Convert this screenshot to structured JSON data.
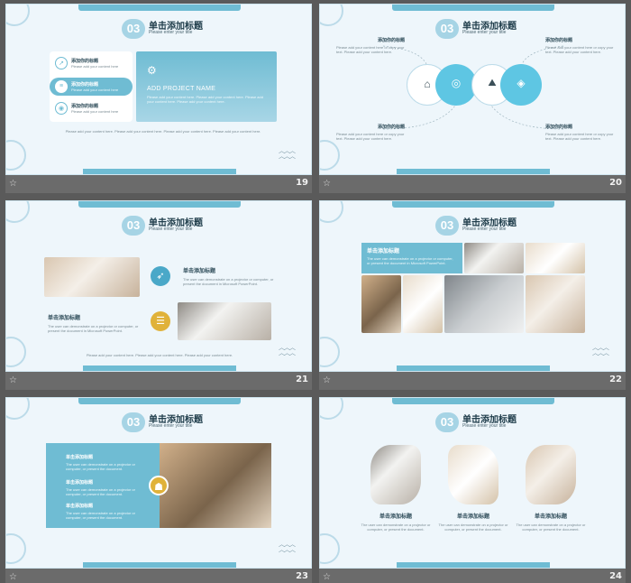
{
  "slide_title": "单击添加标题",
  "slide_subtitle": "Please enter your title",
  "logo_glyph": "03",
  "slides": [
    {
      "number": "19"
    },
    {
      "number": "20"
    },
    {
      "number": "21"
    },
    {
      "number": "22"
    },
    {
      "number": "23"
    },
    {
      "number": "24"
    }
  ],
  "s19": {
    "list": [
      {
        "label": "添加你的标题",
        "desc": "Please add your content here"
      },
      {
        "label": "添加你的标题",
        "desc": "Please add your content here"
      },
      {
        "label": "添加你的标题",
        "desc": "Please add your content here"
      }
    ],
    "project_name": "ADD PROJECT NAME",
    "project_desc": "Please add your content here. Please add your content here. Please add your content here. Please add your content here.",
    "footer": "Please add your content here. Please add your content here. Please add your content here. Please add your content here."
  },
  "s20": {
    "items": [
      {
        "label": "添加你的标题",
        "desc": "Please add your content here or copy your text. Please add your content here."
      },
      {
        "label": "添加你的标题",
        "desc": "Please add your content here or copy your text. Please add your content here."
      },
      {
        "label": "添加你的标题",
        "desc": "Please add your content here or copy your text. Please add your content here."
      },
      {
        "label": "添加你的标题",
        "desc": "Please add your content here or copy your text. Please add your content here."
      }
    ]
  },
  "s21": {
    "blocks": [
      {
        "heading": "单击添加标题",
        "desc": "The user can demonstrate on a projector or computer, or present the document in Microsoft PowerPoint."
      },
      {
        "heading": "单击添加标题",
        "desc": "The user can demonstrate on a projector or computer, or present the document in Microsoft PowerPoint."
      }
    ],
    "footer": "Please add your content here. Please add your content here. Please add your content here."
  },
  "s22": {
    "heading": "单击添加标题",
    "desc": "The user can demonstrate on a projector or computer, or present the document in Microsoft PowerPoint."
  },
  "s23": {
    "blocks": [
      {
        "heading": "单击添加标题",
        "desc": "The user can demonstrate on a projector or computer, or present the document."
      },
      {
        "heading": "单击添加标题",
        "desc": "The user can demonstrate on a projector or computer, or present the document."
      },
      {
        "heading": "单击添加标题",
        "desc": "The user can demonstrate on a projector or computer, or present the document."
      }
    ]
  },
  "s24": {
    "columns": [
      {
        "heading": "单击添加标题",
        "desc": "The user can demonstrate on a projector or computer, or present the document."
      },
      {
        "heading": "单击添加标题",
        "desc": "The user can demonstrate on a projector or computer, or present the document."
      },
      {
        "heading": "单击添加标题",
        "desc": "The user can demonstrate on a projector or computer, or present the document."
      }
    ]
  },
  "colors": {
    "accent": "#6fbcd3",
    "accent_dark": "#4aa8c8",
    "gold": "#e0b23a",
    "background": "#5a5a5a"
  }
}
